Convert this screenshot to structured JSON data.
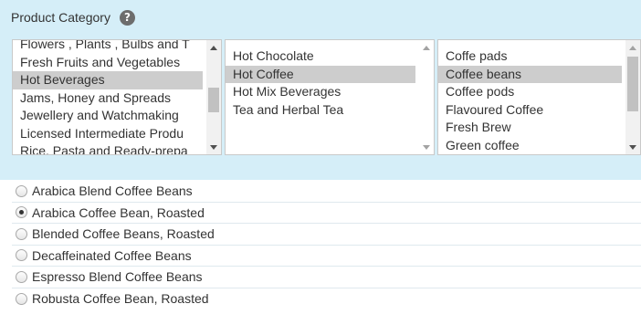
{
  "category_panel": {
    "title": "Product Category",
    "help_icon": "?"
  },
  "listboxes": [
    {
      "items": [
        "Flowers , Plants , Bulbs and T",
        "Fresh Fruits and Vegetables",
        "Hot Beverages",
        "Jams, Honey and Spreads",
        "Jewellery and Watchmaking",
        "Licensed Intermediate Produ",
        "Rice, Pasta and Ready-prepa"
      ],
      "selected_index": 2
    },
    {
      "items": [
        "Hot Chocolate",
        "Hot Coffee",
        "Hot Mix Beverages",
        "Tea and Herbal Tea"
      ],
      "selected_index": 1
    },
    {
      "items": [
        "Coffe pads",
        "Coffee beans",
        "Coffee pods",
        "Flavoured Coffee",
        "Fresh Brew",
        "Green coffee"
      ],
      "selected_index": 1
    }
  ],
  "products": [
    {
      "label": "Arabica Blend Coffee Beans",
      "checked": false
    },
    {
      "label": "Arabica Coffee Bean, Roasted",
      "checked": true
    },
    {
      "label": "Blended Coffee Beans, Roasted",
      "checked": false
    },
    {
      "label": "Decaffeinated Coffee Beans",
      "checked": false
    },
    {
      "label": "Espresso Blend Coffee Beans",
      "checked": false
    },
    {
      "label": "Robusta Coffee Bean, Roasted",
      "checked": false
    }
  ],
  "colors": {
    "panel_background": "#d5eef8",
    "selected_item": "#cdcdcd",
    "help_icon": "#6d6d6d"
  }
}
